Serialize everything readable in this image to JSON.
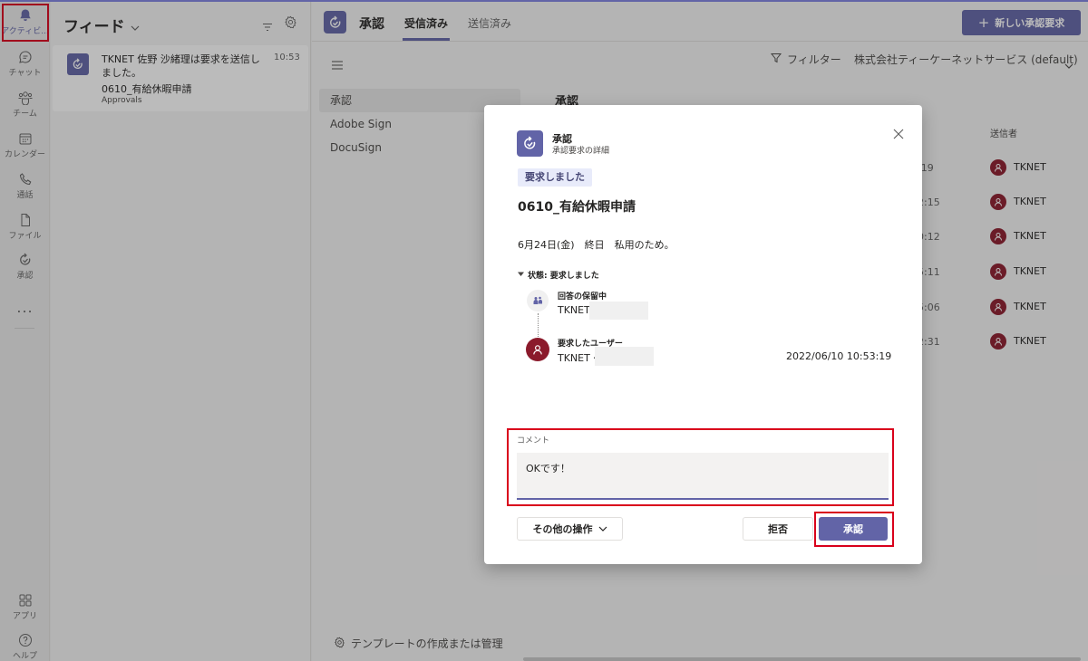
{
  "appbar": {
    "items": [
      {
        "label": "アクティビ...",
        "icon": "bell-icon"
      },
      {
        "label": "チャット",
        "icon": "chat-icon"
      },
      {
        "label": "チーム",
        "icon": "teams-icon"
      },
      {
        "label": "カレンダー",
        "icon": "calendar-icon"
      },
      {
        "label": "通話",
        "icon": "phone-icon"
      },
      {
        "label": "ファイル",
        "icon": "file-icon"
      },
      {
        "label": "承認",
        "icon": "approvals-icon"
      }
    ],
    "more": "...",
    "bottom": [
      {
        "label": "アプリ",
        "icon": "apps-icon"
      },
      {
        "label": "ヘルプ",
        "icon": "help-icon"
      }
    ]
  },
  "feed": {
    "title": "フィード",
    "card": {
      "text": "TKNET 佐野 沙緒理は要求を送信しました。",
      "time": "10:53",
      "subject": "0610_有給休暇申請",
      "source": "Approvals"
    }
  },
  "approvals_app": {
    "name": "承認",
    "tabs": [
      "受信済み",
      "送信済み"
    ],
    "new_button": "新しい承認要求",
    "filter": "フィルター",
    "org": "株式会社ティーケーネットサービス (default)",
    "nav": [
      "承認",
      "Adobe Sign",
      "DocuSign"
    ],
    "content_title": "承認",
    "sender_header": "送信者",
    "rows": [
      {
        "time": ":19",
        "sender": "TKNET"
      },
      {
        "time": "2:15",
        "sender": "TKNET"
      },
      {
        "time": "0:12",
        "sender": "TKNET"
      },
      {
        "time": "5:11",
        "sender": "TKNET"
      },
      {
        "time": "5:06",
        "sender": "TKNET"
      },
      {
        "time": "2:31",
        "sender": "TKNET"
      }
    ],
    "template_link": "テンプレートの作成または管理"
  },
  "modal": {
    "title": "承認",
    "subtitle": "承認要求の詳細",
    "badge": "要求しました",
    "request_title": "0610_有給休暇申請",
    "description": "6月24日(金)　終日　私用のため。",
    "status": "状態: 要求しました",
    "timeline": [
      {
        "heading": "回答の保留中",
        "name": "TKNET"
      },
      {
        "heading": "要求したユーザー",
        "name": "TKNET・",
        "date": "2022/06/10 10:53:19"
      }
    ],
    "comment_label": "コメント",
    "comment_value": "OKです！",
    "more_actions": "その他の操作",
    "reject": "拒否",
    "approve": "承認"
  },
  "colors": {
    "accent": "#6264a7",
    "highlight": "#d9001b",
    "avatar": "#8b1a2b"
  }
}
